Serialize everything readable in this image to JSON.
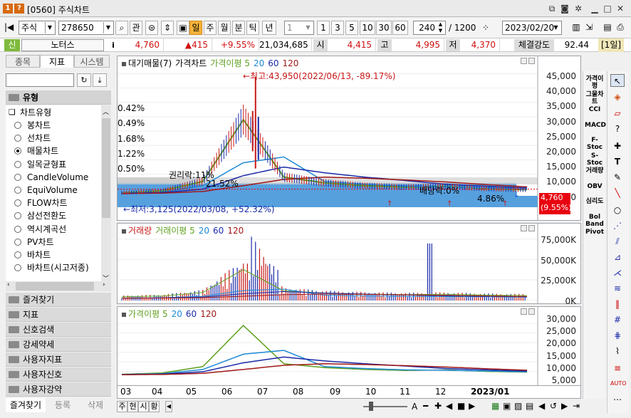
{
  "window": {
    "title": "[0560] 주식차트",
    "help_icon": "?",
    "app_icon": "1"
  },
  "toolbar": {
    "market": "주식",
    "code": "278650",
    "search": "관",
    "periods": [
      "일",
      "주",
      "월",
      "분",
      "틱",
      "년"
    ],
    "interval_value": "1",
    "interval_buttons": [
      "1",
      "3",
      "5",
      "10",
      "30",
      "60"
    ],
    "count_value": "240",
    "count_total": "/ 1200",
    "date": "2023/02/20"
  },
  "quote": {
    "type": "신",
    "name": "노터스",
    "info": "i",
    "price": "4,760",
    "change": "▲415",
    "change_pct": "+9.55%",
    "volume": "21,034,685",
    "open_label": "시",
    "open": "4,415",
    "high_label": "고",
    "high": "4,995",
    "low_label": "저",
    "low": "4,370",
    "strength_label": "체결강도",
    "strength": "92.44",
    "period_tag": "[1일]"
  },
  "left_panel": {
    "tabs": [
      "종목",
      "지표",
      "시스템"
    ],
    "section": "유형",
    "tree_root": "차트유형",
    "items": [
      {
        "label": "봉차트",
        "selected": false
      },
      {
        "label": "선차트",
        "selected": false
      },
      {
        "label": "매물차트",
        "selected": true
      },
      {
        "label": "일목균형표",
        "selected": false
      },
      {
        "label": "CandleVolume",
        "selected": false
      },
      {
        "label": "EquiVolume",
        "selected": false
      },
      {
        "label": "FLOW차트",
        "selected": false
      },
      {
        "label": "삼선전환도",
        "selected": false
      },
      {
        "label": "역시계곡선",
        "selected": false
      },
      {
        "label": "PV차트",
        "selected": false
      },
      {
        "label": "바차트",
        "selected": false
      },
      {
        "label": "바차트(시고저종)",
        "selected": false
      }
    ],
    "categories": [
      "즐겨찾기",
      "지표",
      "신호검색",
      "강세약세",
      "사용자지표",
      "사용자신호",
      "사용자강약"
    ],
    "bottom_tabs": [
      "즐겨찾기",
      "등록",
      "삭제"
    ]
  },
  "price_panel": {
    "legend": [
      {
        "label": "대기매물(7)",
        "color": "#000000"
      },
      {
        "label": "가격차트",
        "color": "#000000"
      },
      {
        "label": "가격이평 5",
        "color": "#5fa020"
      },
      {
        "label": "20",
        "color": "#1e8ad6"
      },
      {
        "label": "60",
        "color": "#1a2aa8"
      },
      {
        "label": "120",
        "color": "#a01818"
      }
    ],
    "high_note": "←최고:43,950(2022/06/13, -89.17%)",
    "low_note": "←최저:3,125(2022/03/08, +52.32%)",
    "rights_note": "권리락:11%",
    "rights_pct": "21.52%",
    "dividend_note": "배당락:0%",
    "right_pct": "4.86%",
    "volume_profile_pcts": [
      "0.42%",
      "0.49%",
      "1.68%",
      "1.22%",
      "0.50%"
    ],
    "current_price_tag": "4,760",
    "current_pct_tag": "(9.55%)",
    "yticks": [
      "45,000",
      "40,000",
      "35,000",
      "30,000",
      "25,000",
      "20,000",
      "15,000",
      "10,000",
      "5,000"
    ]
  },
  "volume_panel": {
    "legend": [
      {
        "label": "거래량",
        "color": "#c81818"
      },
      {
        "label": "거래이평 5",
        "color": "#5fa020"
      },
      {
        "label": "20",
        "color": "#1e8ad6"
      },
      {
        "label": "60",
        "color": "#1a2aa8"
      },
      {
        "label": "120",
        "color": "#a01818"
      }
    ],
    "yticks": [
      "75,000K",
      "50,000K",
      "25,000K",
      "0K"
    ]
  },
  "ma_panel": {
    "legend": [
      {
        "label": "가격이평 5",
        "color": "#5fa020"
      },
      {
        "label": "20",
        "color": "#1e8ad6"
      },
      {
        "label": "60",
        "color": "#1a2aa8"
      },
      {
        "label": "120",
        "color": "#a01818"
      }
    ],
    "yticks": [
      "30,000",
      "25,000",
      "20,000",
      "15,000",
      "10,000",
      "5,000"
    ]
  },
  "x_axis": {
    "labels": [
      "03",
      "04",
      "05",
      "06",
      "07",
      "08",
      "09",
      "10",
      "11",
      "12",
      "2023/01"
    ]
  },
  "right_tools": [
    "가격이평",
    "그물차트",
    "CCI",
    "MACD",
    "F-Stoc",
    "S-Stoc",
    "거래량",
    "OBV",
    "심리도",
    "Bol Band",
    "Pivot"
  ],
  "bottom_bar": {
    "scale_tabs": [
      "주",
      "현",
      "시",
      "황"
    ],
    "text_tool": "A"
  },
  "chart_data": {
    "type": "line",
    "x": [
      "03",
      "04",
      "05",
      "06",
      "07",
      "08",
      "09",
      "10",
      "11",
      "12",
      "2023/01"
    ],
    "price_range": [
      3125,
      43950
    ],
    "high": {
      "value": 43950,
      "date": "2022/06/13"
    },
    "low": {
      "value": 3125,
      "date": "2022/03/08"
    },
    "last": 4760,
    "series": [
      {
        "name": "가격이평 5",
        "values": [
          3500,
          4200,
          7500,
          29000,
          9000,
          7000,
          6000,
          5500,
          5800,
          5000,
          4600
        ]
      },
      {
        "name": "20",
        "values": [
          3400,
          3800,
          6000,
          14000,
          16000,
          7500,
          6500,
          5800,
          5600,
          5200,
          4800
        ]
      },
      {
        "name": "60",
        "values": [
          3300,
          3600,
          4800,
          9500,
          12500,
          10500,
          9000,
          7800,
          6500,
          5800,
          5200
        ]
      },
      {
        "name": "120",
        "values": [
          3300,
          3400,
          4000,
          6000,
          8200,
          9000,
          8600,
          8000,
          7300,
          6400,
          5600
        ]
      }
    ]
  }
}
